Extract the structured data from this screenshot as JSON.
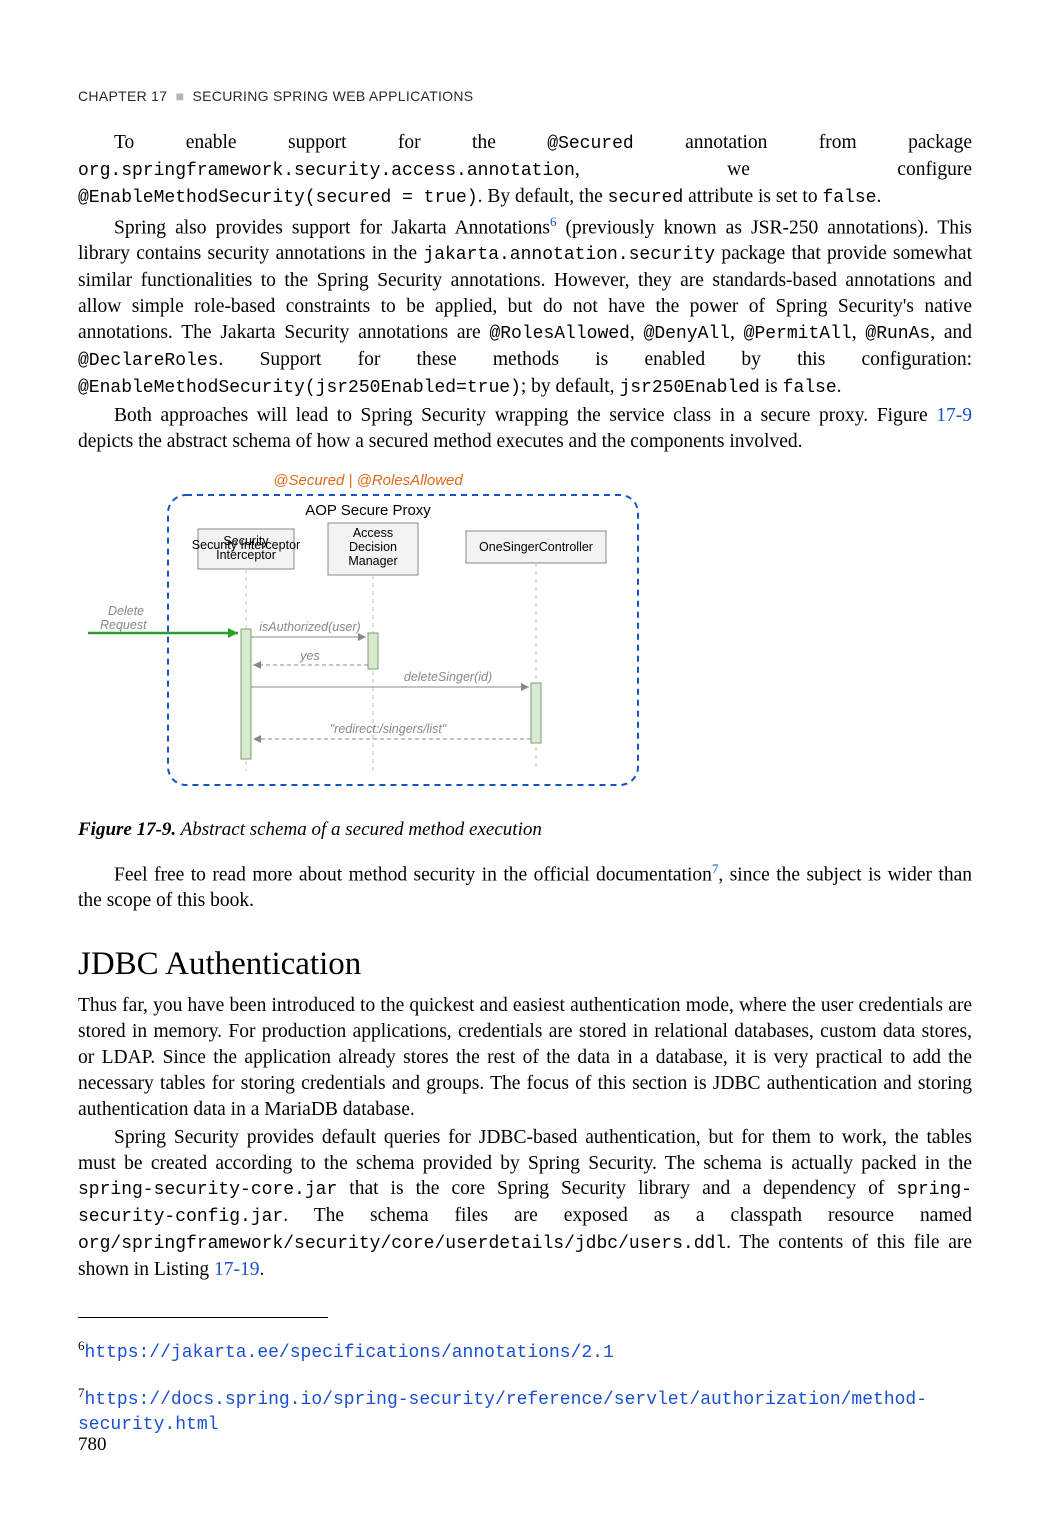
{
  "header": {
    "chapter": "CHAPTER 17",
    "sep": "■",
    "title": "SECURING SPRING WEB APPLICATIONS"
  },
  "para1": {
    "a": "To enable support for the ",
    "b": "@Secured",
    "c": " annotation from package ",
    "d": "org.springframework.security.access.annotation",
    "e": ", we configure ",
    "f": "@EnableMethodSecurity(secured = true)",
    "g": ". By default, the ",
    "h": "secured",
    "i": " attribute is set to ",
    "j": "false",
    "k": "."
  },
  "para2": {
    "a": "Spring also provides support for Jakarta Annotations",
    "b": " (previously known as JSR-250 annotations). This library contains security annotations in the ",
    "c": "jakarta.annotation.security",
    "d": " package that provide somewhat similar functionalities to the Spring Security annotations. However, they are standards-based annotations and allow simple role-based constraints to be applied, but do not have the power of Spring Security's native annotations. The Jakarta Security annotations are ",
    "e": "@RolesAllowed",
    "f": "@DenyAll",
    "g": "@PermitAll",
    "h": "@RunAs",
    "i": ", and ",
    "j": "@DeclareRoles",
    "k": ". Support for these methods is enabled by this configuration: ",
    "l": "@EnableMethodSecurity(jsr250Enabled=true)",
    "m": "; by default, ",
    "n": "jsr250Enabled",
    "o": " is ",
    "p": "false",
    "q": "."
  },
  "para3": {
    "a": "Both approaches will lead to Spring Security wrapping the service class in a secure proxy. Figure ",
    "b": "17-9",
    "c": " depicts the abstract schema of how a secured method executes and the components involved."
  },
  "figure": {
    "header_anno": "@Secured   |   @RolesAllowed",
    "proxy_label": "AOP Secure Proxy",
    "box1": "Security Interceptor",
    "box2a": "Access",
    "box2b": "Decision",
    "box2c": "Manager",
    "box3": "OneSingerController",
    "delete_a": "Delete",
    "delete_b": "Request",
    "isauth": "isAuthorized(user)",
    "yes": "yes",
    "call": "deleteSinger(id)",
    "redirect": "\"redirect:/singers/list\"",
    "caption_label": "Figure 17-9.",
    "caption_title": " Abstract schema of a secured method execution"
  },
  "para4": {
    "a": "Feel free to read more about method security in the official documentation",
    "b": ", since the subject is wider than the scope of this book."
  },
  "section": "JDBC Authentication",
  "para5": {
    "a": "Thus far, you have been introduced to the quickest and easiest authentication mode, where the user credentials are stored in memory. For production applications, credentials are stored in relational databases, custom data stores, or LDAP. Since the application already stores the rest of the data in a database, it is very practical to add the necessary tables for storing credentials and groups. The focus of this section is JDBC authentication and storing authentication data in a MariaDB database."
  },
  "para6": {
    "a": "Spring Security provides default queries for JDBC-based authentication, but for them to work, the tables must be created according to the schema provided by Spring Security. The schema is actually packed in the ",
    "b": "spring-security-core.jar",
    "c": " that is the core Spring Security library and a dependency of ",
    "d": "spring-security-config.jar",
    "e": ". The schema files are exposed as a classpath resource named ",
    "f": "org/springframework/security/core/userdetails/jdbc/users.ddl",
    "g": ". The contents of this file are shown in Listing ",
    "h": "17-19",
    "i": "."
  },
  "footnotes": {
    "n6": "6",
    "link6": "https://jakarta.ee/specifications/annotations/2.1",
    "n7": "7",
    "link7": "https://docs.spring.io/spring-security/reference/servlet/authorization/method-security.html"
  },
  "pagenum": "780"
}
